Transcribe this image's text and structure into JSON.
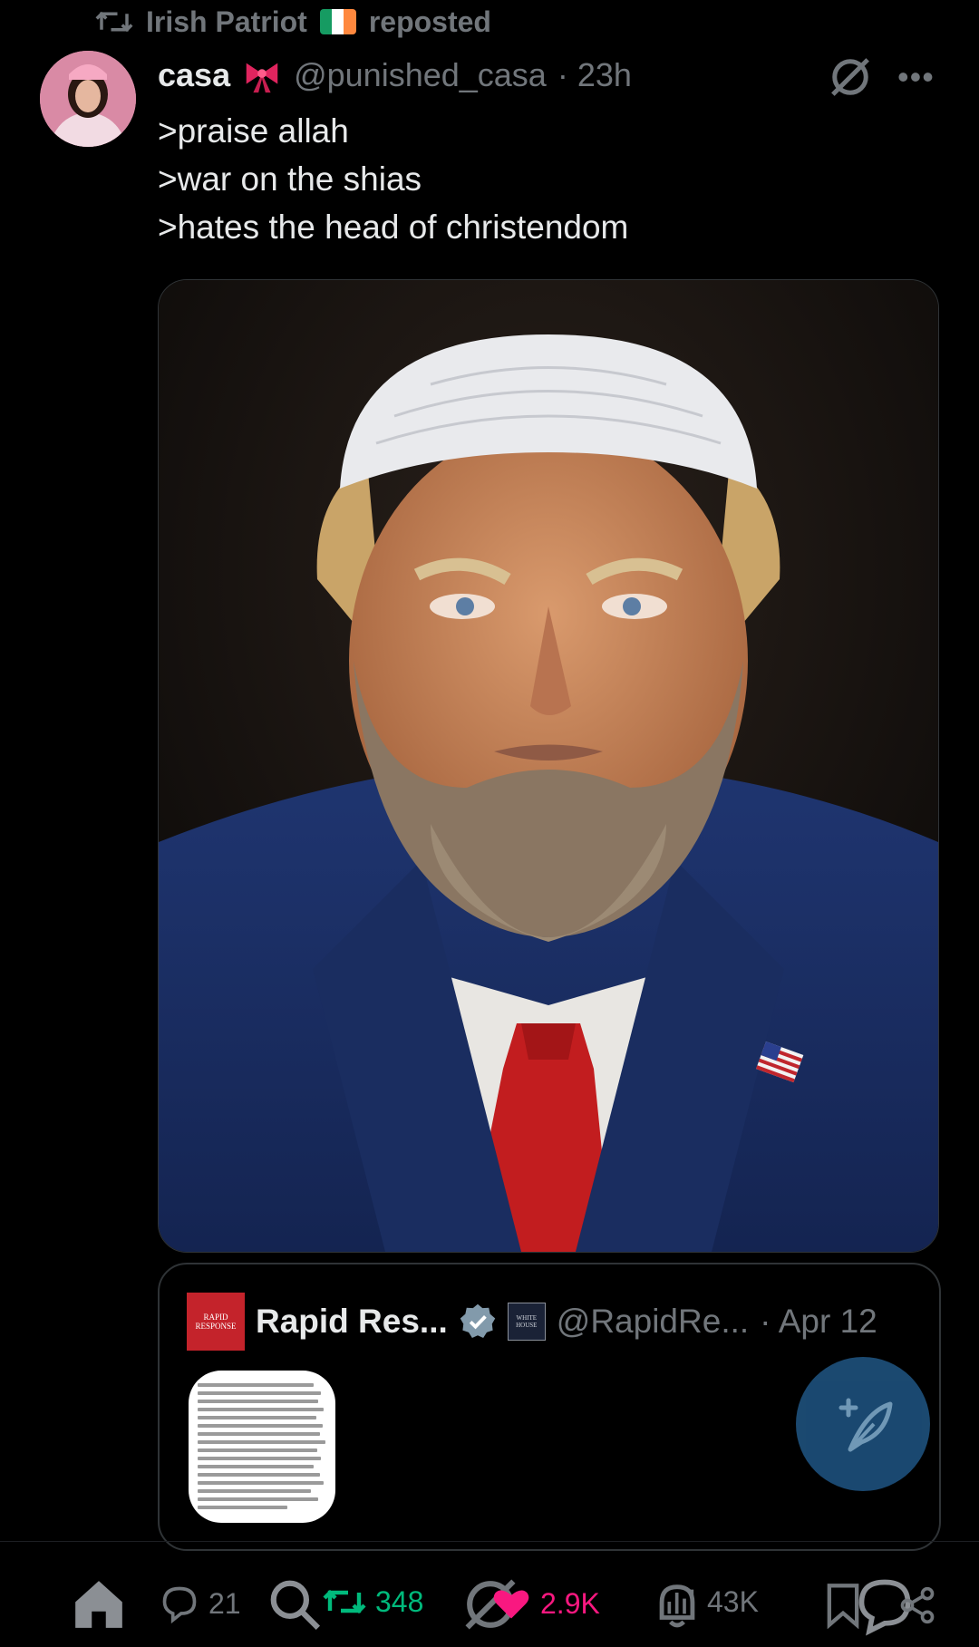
{
  "repost": {
    "user": "Irish Patriot",
    "label": "reposted",
    "flag_colors": [
      "#169b62",
      "#ffffff",
      "#ff883e"
    ]
  },
  "post": {
    "name": "casa",
    "handle": "@punished_casa",
    "time": "· 23h",
    "lines": [
      ">praise allah",
      ">war on the shias",
      ">hates the head of christendom"
    ]
  },
  "quote": {
    "logo_text": "RAPID RESPONSE",
    "name": "Rapid Res...",
    "affiliate_badge": "WHITE HOUSE",
    "handle": "@RapidRe...",
    "date": "· Apr 12"
  },
  "actions": {
    "replies": "21",
    "reposts": "348",
    "likes": "2.9K",
    "views": "43K"
  },
  "colors": {
    "background": "#000000",
    "text": "#e7e9ea",
    "muted": "#71767b",
    "repost_green": "#00ba7c",
    "like_pink": "#f91880",
    "verified_blue": "#1d9bf0"
  }
}
